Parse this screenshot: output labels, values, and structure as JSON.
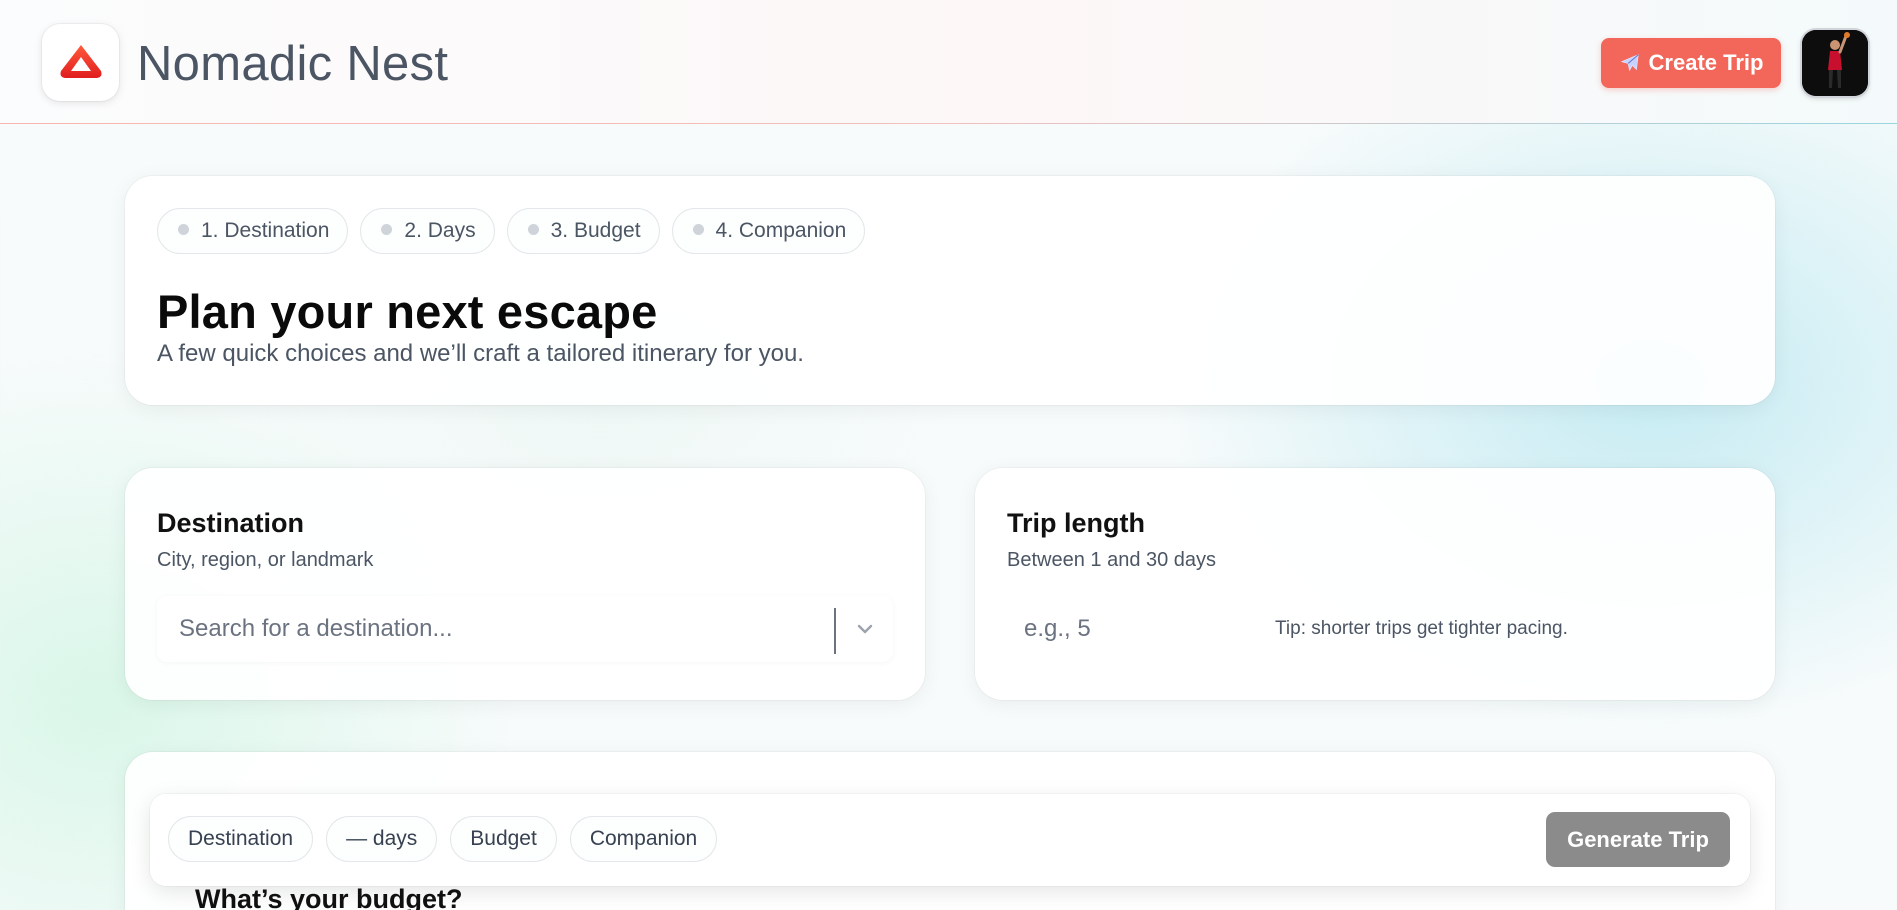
{
  "header": {
    "brand": "Nomadic Nest",
    "create_trip_label": "Create Trip",
    "create_trip_icon": "airplane-icon",
    "logo_icon": "tent-logo-icon",
    "accent_color": "#f2675a"
  },
  "hero": {
    "steps": [
      "1. Destination",
      "2. Days",
      "3. Budget",
      "4. Companion"
    ],
    "title": "Plan your next escape",
    "subtitle": "A few quick choices and we’ll craft a tailored itinerary for you."
  },
  "destination": {
    "title": "Destination",
    "subtitle": "City, region, or landmark",
    "placeholder": "Search for a destination..."
  },
  "trip_length": {
    "title": "Trip length",
    "subtitle": "Between 1 and 30 days",
    "placeholder": "e.g., 5",
    "tip": "Tip: shorter trips get tighter pacing."
  },
  "budget": {
    "title": "What’s your budget?"
  },
  "summary": {
    "chips": [
      "Destination",
      "— days",
      "Budget",
      "Companion"
    ],
    "generate_label": "Generate Trip"
  }
}
